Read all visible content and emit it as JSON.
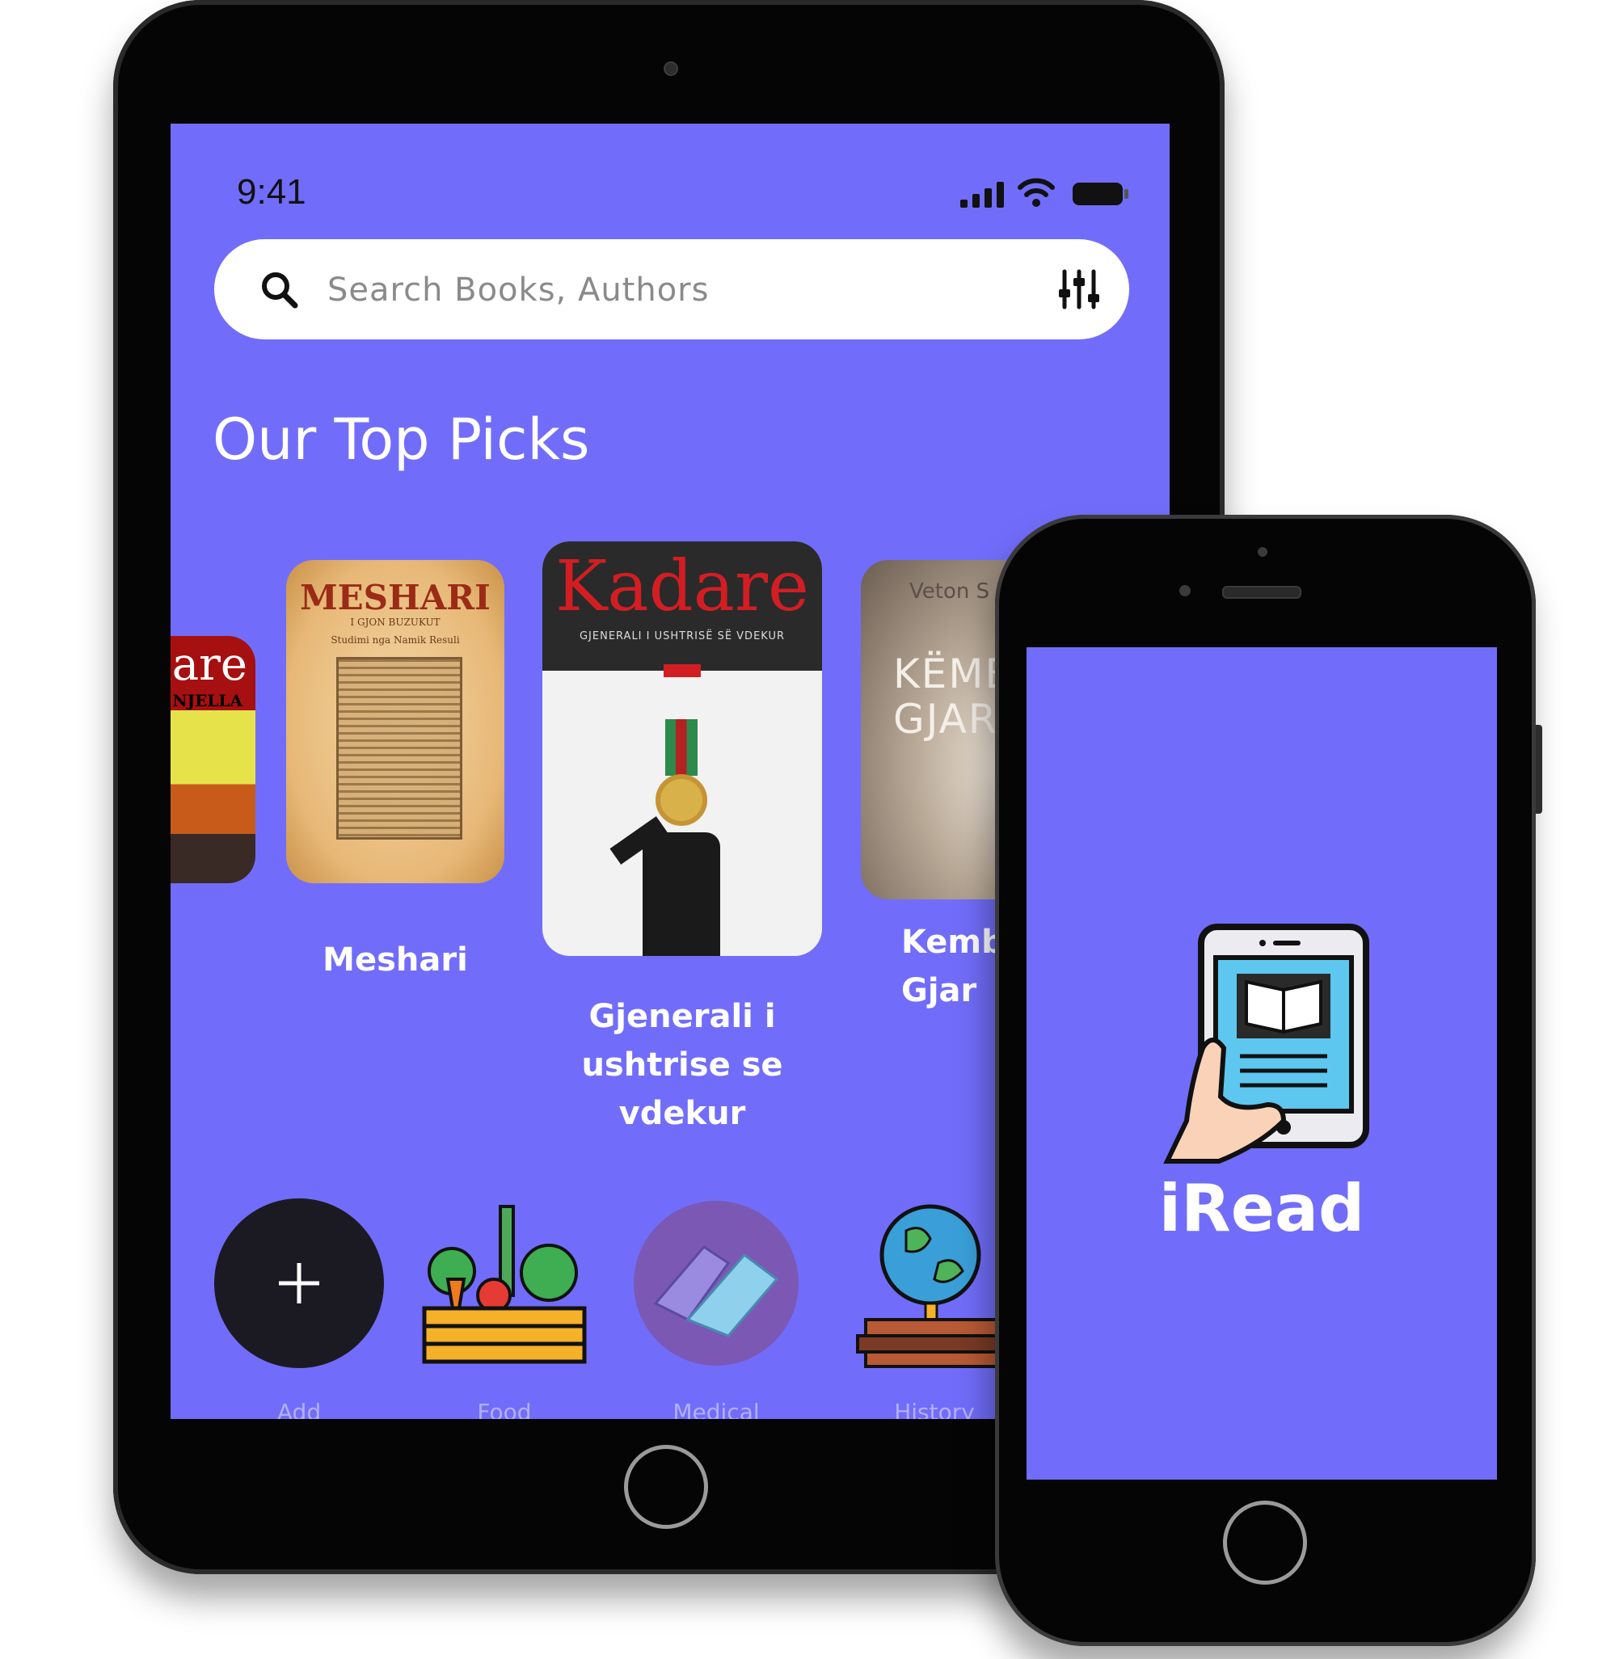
{
  "tablet": {
    "status": {
      "time": "9:41"
    },
    "search": {
      "placeholder": "Search Books, Authors"
    },
    "section_title": "Our Top Picks",
    "books": [
      {
        "cover_title": "Kadare",
        "cover_subtitle": "NJELLA",
        "title": ""
      },
      {
        "cover_title": "MESHARI",
        "cover_subtitle": "I GJON BUZUKUT",
        "cover_subtitle2": "Studimi nga Namik Resuli",
        "title": "Meshari"
      },
      {
        "cover_title": "Kadare",
        "cover_subtitle": "GJENERALI I USHTRISË SË VDEKUR",
        "title": "Gjenerali i ushtrise se vdekur"
      },
      {
        "cover_author": "Veton S",
        "cover_title_line1": "KËMB",
        "cover_title_line2": "GJAR",
        "title": "Kemb Gjar"
      }
    ],
    "categories": [
      {
        "label": "Add",
        "icon": "plus-icon"
      },
      {
        "label": "Food",
        "icon": "vegetable-crate-icon"
      },
      {
        "label": "Medical",
        "icon": "gloved-hands-icon"
      },
      {
        "label": "History",
        "icon": "globe-books-icon"
      }
    ]
  },
  "phone": {
    "app_name": "iRead",
    "logo_icon": "hand-holding-ebook-icon"
  },
  "colors": {
    "screen_background": "#716dfa",
    "device_frame": "#050505",
    "add_button": "#1b1a23"
  }
}
